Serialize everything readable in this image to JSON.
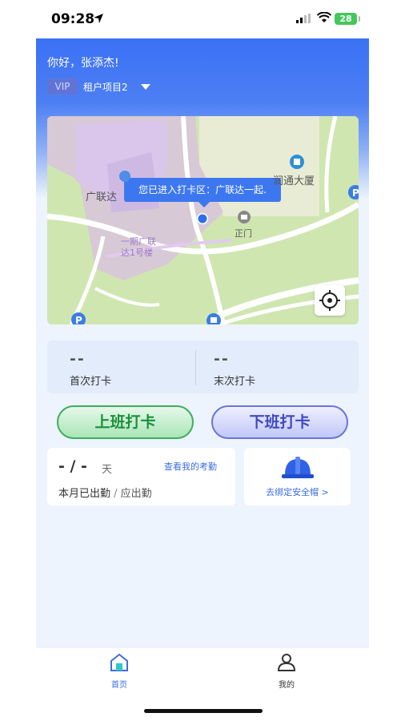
{
  "status_bar": {
    "time": "09:28",
    "battery": "28"
  },
  "header": {
    "greeting": "你好，张添杰!",
    "vip_label": "VIP",
    "project_name": "租户项目2"
  },
  "map": {
    "tooltip": "您已进入打卡区：广联达一起.",
    "labels": {
      "building_left": "广联达",
      "building_right": "润通大厦",
      "gate": "正门",
      "phase_line1": "一期广联",
      "phase_line2": "达1号楼"
    },
    "icons": [
      "pin-icon",
      "parking-icon",
      "bus-stop-icon",
      "crosshair-icon"
    ]
  },
  "punch": {
    "first_value": "--",
    "first_label": "首次打卡",
    "last_value": "--",
    "last_label": "末次打卡"
  },
  "actions": {
    "clock_in": "上班打卡",
    "clock_out": "下班打卡"
  },
  "attendance": {
    "value": "- / -",
    "unit": "天",
    "link": "查看我的考勤",
    "desc_main": "本月已出勤",
    "desc_sep": " / ",
    "desc_sub": "应出勤"
  },
  "helmet": {
    "link": "去绑定安全帽 >"
  },
  "tabbar": {
    "home": "首页",
    "me": "我的",
    "active_color": "#3a6ee0"
  },
  "colors": {
    "primary": "#3a71f4",
    "on_green": "#1a8f3d",
    "off_purple": "#3f49c0"
  }
}
